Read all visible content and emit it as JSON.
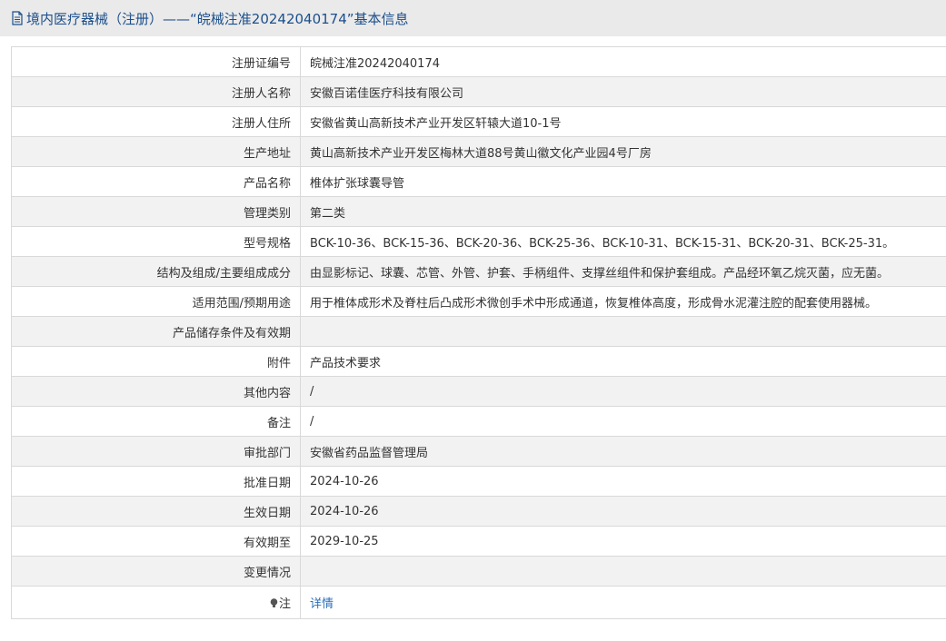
{
  "header": {
    "title": "境内医疗器械（注册）——“皖械注准20242040174”基本信息"
  },
  "rows": [
    {
      "label": "注册证编号",
      "value": "皖械注准20242040174"
    },
    {
      "label": "注册人名称",
      "value": "安徽百诺佳医疗科技有限公司"
    },
    {
      "label": "注册人住所",
      "value": "安徽省黄山高新技术产业开发区轩辕大道10-1号"
    },
    {
      "label": "生产地址",
      "value": "黄山高新技术产业开发区梅林大道88号黄山徽文化产业园4号厂房"
    },
    {
      "label": "产品名称",
      "value": "椎体扩张球囊导管"
    },
    {
      "label": "管理类别",
      "value": "第二类"
    },
    {
      "label": "型号规格",
      "value": "BCK-10-36、BCK-15-36、BCK-20-36、BCK-25-36、BCK-10-31、BCK-15-31、BCK-20-31、BCK-25-31。"
    },
    {
      "label": "结构及组成/主要组成成分",
      "value": "由显影标记、球囊、芯管、外管、护套、手柄组件、支撑丝组件和保护套组成。产品经环氧乙烷灭菌，应无菌。"
    },
    {
      "label": "适用范围/预期用途",
      "value": "用于椎体成形术及脊柱后凸成形术微创手术中形成通道，恢复椎体高度，形成骨水泥灌注腔的配套使用器械。"
    },
    {
      "label": "产品储存条件及有效期",
      "value": ""
    },
    {
      "label": "附件",
      "value": "产品技术要求"
    },
    {
      "label": "其他内容",
      "value": "/"
    },
    {
      "label": "备注",
      "value": "/"
    },
    {
      "label": "审批部门",
      "value": "安徽省药品监督管理局"
    },
    {
      "label": "批准日期",
      "value": "2024-10-26"
    },
    {
      "label": "生效日期",
      "value": "2024-10-26"
    },
    {
      "label": "有效期至",
      "value": "2029-10-25"
    },
    {
      "label": "变更情况",
      "value": ""
    }
  ],
  "note_row": {
    "icon": "lightbulb-icon",
    "label": "注",
    "link_text": "详情"
  },
  "colors": {
    "header_bg": "#eaeaea",
    "title": "#1c4f8c",
    "link": "#2a6ebb",
    "row_alt": "#f2f2f2",
    "border": "#d9d9d9"
  }
}
